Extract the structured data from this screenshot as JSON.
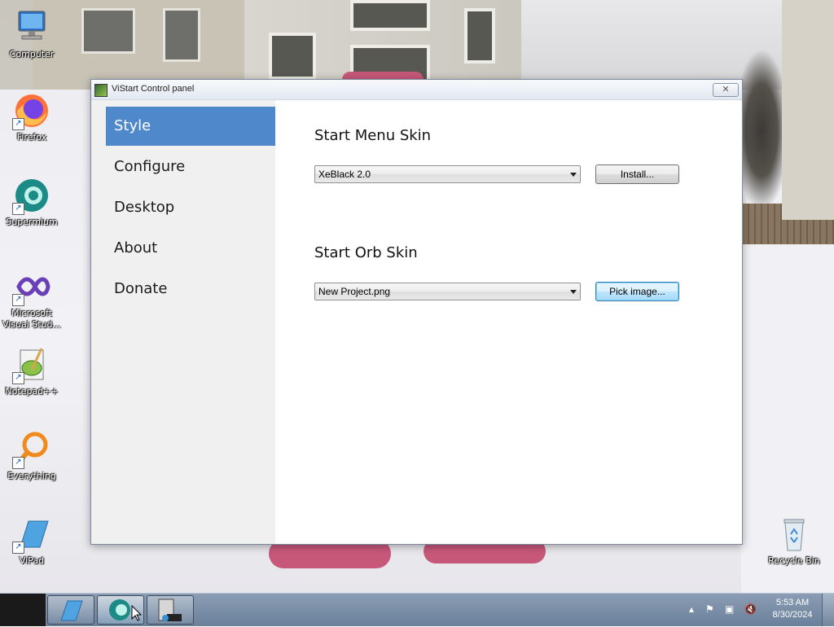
{
  "desktop": {
    "icons": [
      {
        "label": "Computer",
        "icon": "computer-icon"
      },
      {
        "label": "Firefox",
        "icon": "firefox-icon"
      },
      {
        "label": "Supermium",
        "icon": "supermium-icon"
      },
      {
        "label": "Microsoft Visual Stud...",
        "icon": "visual-studio-icon"
      },
      {
        "label": "Notepad++",
        "icon": "notepadpp-icon"
      },
      {
        "label": "Everything",
        "icon": "everything-icon"
      },
      {
        "label": "ViPad",
        "icon": "vipad-icon"
      },
      {
        "label": "Recycle Bin",
        "icon": "recycle-bin-icon"
      }
    ]
  },
  "window": {
    "title": "ViStart Control panel",
    "close_glyph": "✕"
  },
  "sidebar": {
    "items": [
      {
        "label": "Style",
        "active": true
      },
      {
        "label": "Configure",
        "active": false
      },
      {
        "label": "Desktop",
        "active": false
      },
      {
        "label": "About",
        "active": false
      },
      {
        "label": "Donate",
        "active": false
      }
    ]
  },
  "content": {
    "menu_skin": {
      "title": "Start Menu Skin",
      "selected": "XeBlack 2.0",
      "button": "Install..."
    },
    "orb_skin": {
      "title": "Start Orb Skin",
      "selected": "New Project.png",
      "button": "Pick image..."
    }
  },
  "taskbar": {
    "clock_time": "5:53 AM",
    "clock_date": "8/30/2024",
    "tray_icons": [
      "show-hidden-icon",
      "action-center-flag-icon",
      "network-icon",
      "volume-muted-icon"
    ]
  },
  "colors": {
    "accent": "#4f89cc",
    "focused_button": "#bee6fd"
  }
}
